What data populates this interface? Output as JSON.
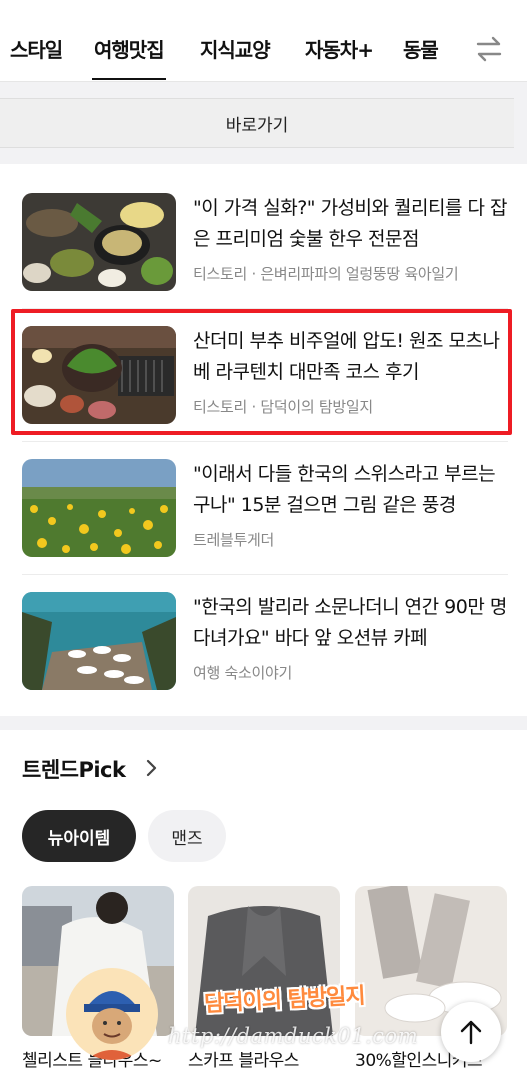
{
  "tabs": [
    {
      "label": "스타일",
      "active": false
    },
    {
      "label": "여행맛집",
      "active": true
    },
    {
      "label": "지식교양",
      "active": false
    },
    {
      "label": "자동차+",
      "active": false
    },
    {
      "label": "동물",
      "active": false
    }
  ],
  "icons": {
    "tab_switch": "swap-arrows-icon",
    "trend_more": "chevron-right-icon",
    "scroll_top": "arrow-up-icon"
  },
  "shortcut": {
    "label": "바로가기"
  },
  "articles": [
    {
      "title": "\"이 가격 실화?\" 가성비와 퀄리티를 다 잡은 프리미엄 숯불 한우 전문점",
      "source": "티스토리 · 은벼리파파의 얼렁뚱땅 육아일기"
    },
    {
      "title": "산더미 부추 비주얼에 압도! 원조 모츠나베 라쿠텐치 대만족 코스 후기",
      "source": "티스토리 · 담덕이의 탐방일지"
    },
    {
      "title": "\"이래서 다들 한국의 스위스라고 부르는구나\" 15분 걸으면 그림 같은 풍경",
      "source": "트레블투게더"
    },
    {
      "title": "\"한국의 발리라 소문나더니 연간 90만 명 다녀가요\" 바다 앞 오션뷰 카페",
      "source": "여행 숙소이야기"
    }
  ],
  "trend": {
    "title": "트렌드Pick",
    "chips": [
      {
        "label": "뉴아이템",
        "active": true
      },
      {
        "label": "맨즈",
        "active": false
      }
    ],
    "products": [
      {
        "label": "첼리스트 블라우스~"
      },
      {
        "label": "스카프 블라우스"
      },
      {
        "label": "30%할인스니커즈"
      }
    ]
  },
  "overlay": {
    "watermark": "http://damduck01.com",
    "blog_name": "담덕이의 탐방일지"
  },
  "colors": {
    "highlight": "#ee1c24",
    "chip_active": "#262626",
    "blog_name": "#ff8a3d"
  }
}
